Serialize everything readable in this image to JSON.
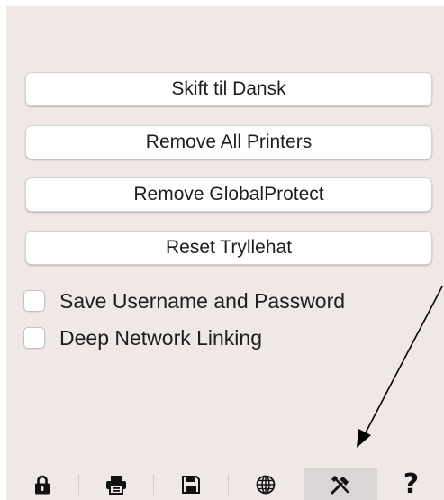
{
  "buttons": {
    "switch_language": "Skift til Dansk",
    "remove_printers": "Remove All Printers",
    "remove_globalprotect": "Remove GlobalProtect",
    "reset_tryllehat": "Reset Tryllehat"
  },
  "checkboxes": [
    {
      "label": "Save Username and Password",
      "checked": false
    },
    {
      "label": "Deep Network Linking",
      "checked": false
    }
  ],
  "tabs": [
    {
      "icon": "lock-icon",
      "active": false
    },
    {
      "icon": "printer-icon",
      "active": false
    },
    {
      "icon": "save-icon",
      "active": false
    },
    {
      "icon": "globe-icon",
      "active": false
    },
    {
      "icon": "tools-icon",
      "active": true
    },
    {
      "icon": "help-icon",
      "glyph": "?",
      "active": false
    }
  ],
  "colors": {
    "panel_background": "#f0e7e7",
    "button_background": "#ffffff",
    "active_tab": "#dcd5d5",
    "annotation_arrow": "#000000"
  }
}
